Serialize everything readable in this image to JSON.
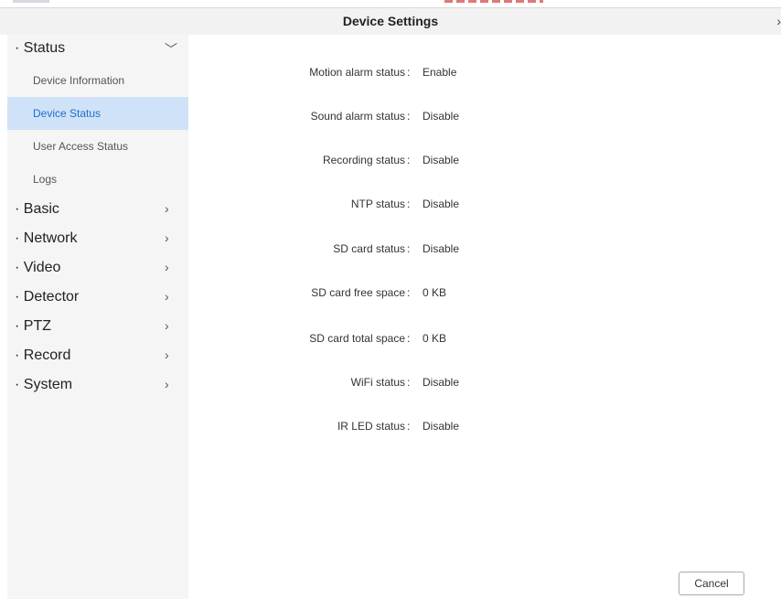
{
  "window": {
    "title": "Device Settings",
    "close_glyph": "›"
  },
  "sidebar": {
    "groups": [
      {
        "label": "· Status",
        "arrow": "﹀",
        "expanded": true,
        "items": [
          {
            "label": "Device Information",
            "active": false
          },
          {
            "label": "Device Status",
            "active": true
          },
          {
            "label": "User Access Status",
            "active": false
          },
          {
            "label": "Logs",
            "active": false
          }
        ]
      },
      {
        "label": "· Basic",
        "arrow": "›"
      },
      {
        "label": "· Network",
        "arrow": "›"
      },
      {
        "label": "· Video",
        "arrow": "›"
      },
      {
        "label": "· Detector",
        "arrow": "›"
      },
      {
        "label": "· PTZ",
        "arrow": "›"
      },
      {
        "label": "· Record",
        "arrow": "›"
      },
      {
        "label": "· System",
        "arrow": "›"
      }
    ]
  },
  "status": {
    "separator": ":",
    "rows": [
      {
        "label": "Motion alarm status",
        "value": "Enable"
      },
      {
        "label": "Sound alarm status",
        "value": "Disable"
      },
      {
        "label": "Recording status",
        "value": "Disable"
      },
      {
        "label": "NTP status",
        "value": "Disable"
      },
      {
        "label": "SD card status",
        "value": "Disable"
      },
      {
        "label": "SD card free space",
        "value": "0 KB"
      },
      {
        "label": "SD card total space",
        "value": "0 KB"
      },
      {
        "label": "WiFi status",
        "value": "Disable"
      },
      {
        "label": "IR LED status",
        "value": "Disable"
      }
    ]
  },
  "footer": {
    "cancel_label": "Cancel"
  },
  "colors": {
    "active_item_bg": "#cfe2f7",
    "active_item_text": "#1f6fd1",
    "sidebar_bg": "#f5f5f5",
    "titlebar_bg": "#f2f2f2"
  }
}
